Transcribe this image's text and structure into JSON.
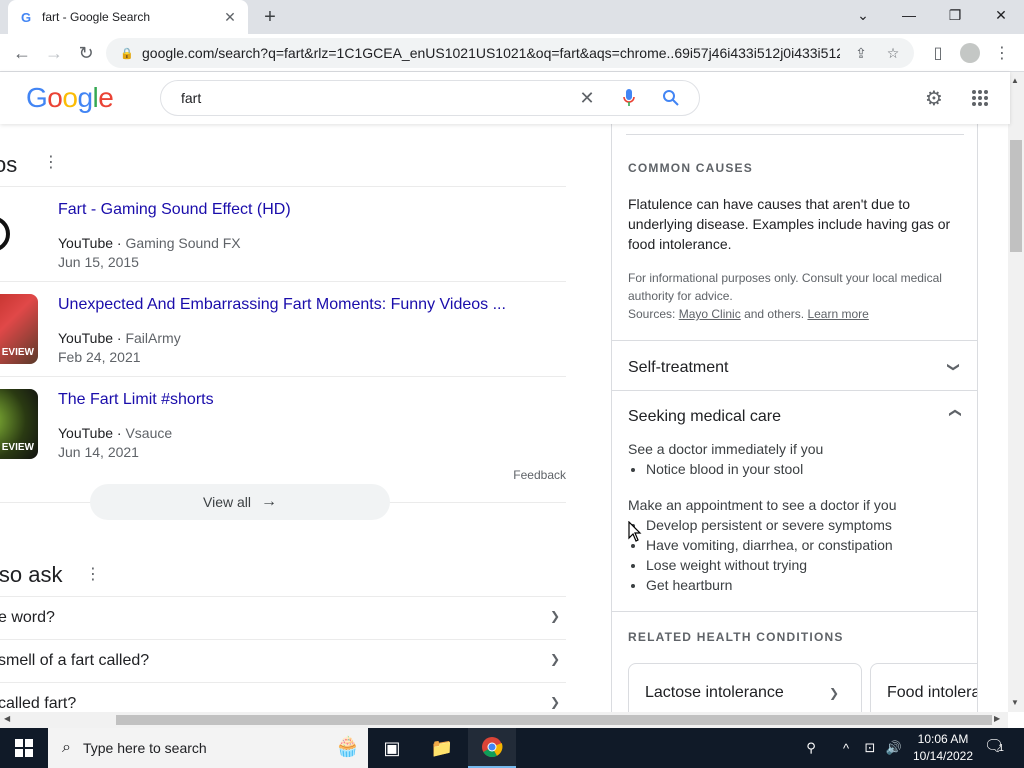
{
  "browser": {
    "tab_title": "fart - Google Search",
    "url": "google.com/search?q=fart&rlz=1C1GCEA_enUS1021US1021&oq=fart&aqs=chrome..69i57j46i433i512j0i433i512..."
  },
  "google": {
    "logo_letters": [
      "G",
      "o",
      "o",
      "g",
      "l",
      "e"
    ],
    "query": "fart"
  },
  "videos": {
    "heading_fragment": "os",
    "items": [
      {
        "title": "Fart - Gaming Sound Effect (HD)",
        "source": "YouTube",
        "channel": "Gaming Sound FX",
        "date": "Jun 15, 2015",
        "badge": ""
      },
      {
        "title": "Unexpected And Embarrassing Fart Moments: Funny Videos ...",
        "source": "YouTube",
        "channel": "FailArmy",
        "date": "Feb 24, 2021",
        "badge": "EVIEW"
      },
      {
        "title": "The Fart Limit #shorts",
        "source": "YouTube",
        "channel": "Vsauce",
        "date": "Jun 14, 2021",
        "badge": "EVIEW"
      }
    ],
    "feedback": "Feedback",
    "view_all": "View all"
  },
  "people_also_ask": {
    "heading_fragment": "lso ask",
    "questions": [
      "e word?",
      "smell of a fart called?",
      "called fart?"
    ]
  },
  "knowledge_panel": {
    "common_causes_heading": "COMMON CAUSES",
    "common_causes_text": "Flatulence can have causes that aren't due to underlying disease. Examples include having gas or food intolerance.",
    "disclaimer": "For informational purposes only. Consult your local medical authority for advice.",
    "sources_label": "Sources:",
    "source_link": "Mayo Clinic",
    "sources_others": "and others.",
    "learn_more": "Learn more",
    "self_treatment": "Self-treatment",
    "seeking_care": "Seeking medical care",
    "see_doctor_now": "See a doctor immediately if you",
    "urgent_items": [
      "Notice blood in your stool"
    ],
    "make_appointment": "Make an appointment to see a doctor if you",
    "appointment_items": [
      "Develop persistent or severe symptoms",
      "Have vomiting, diarrhea, or constipation",
      "Lose weight without trying",
      "Get heartburn"
    ],
    "related_heading": "RELATED HEALTH CONDITIONS",
    "related": [
      "Lactose intolerance",
      "Food intolera"
    ]
  },
  "taskbar": {
    "search_placeholder": "Type here to search",
    "time": "10:06 AM",
    "date": "10/14/2022",
    "notif_count": "1"
  },
  "colors": {
    "link": "#1a0dab",
    "taskbar": "#101a28",
    "accent_blue": "#4285f4"
  }
}
